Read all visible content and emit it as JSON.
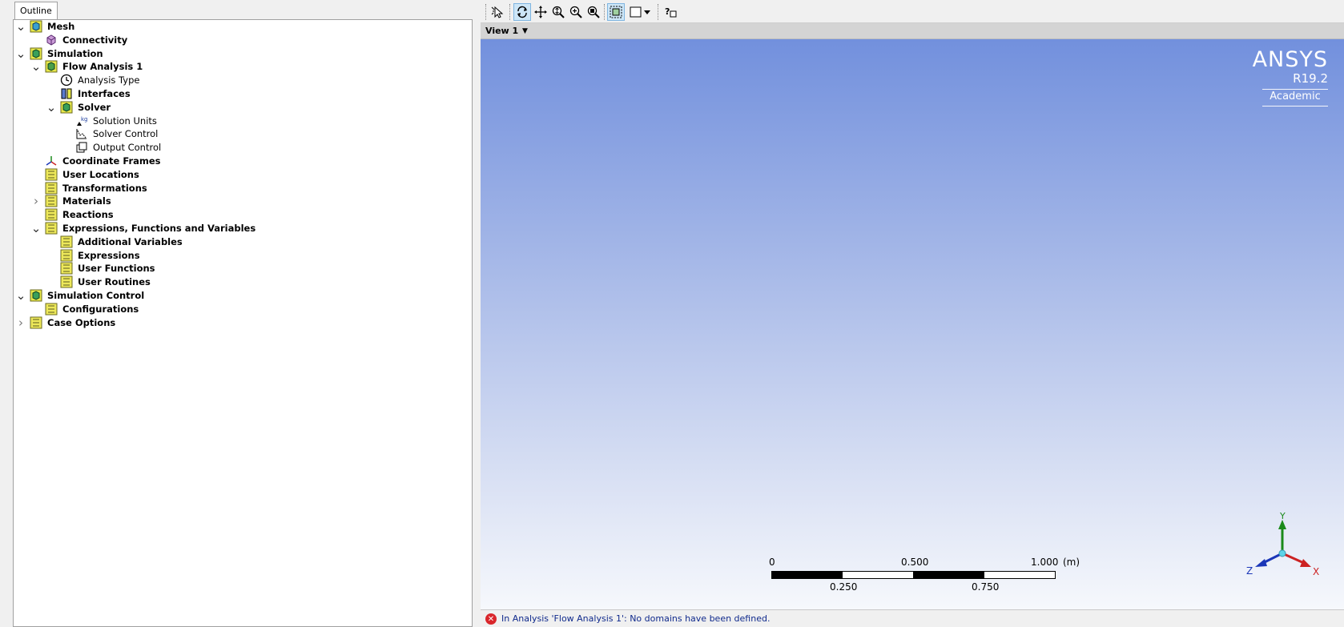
{
  "outline": {
    "tab_label": "Outline",
    "items": [
      {
        "label": "Mesh",
        "bold": true,
        "twisty": "expanded",
        "icon": "mesh-icon"
      },
      {
        "label": "Connectivity",
        "bold": true,
        "twisty": "none",
        "icon": "connectivity-icon"
      },
      {
        "label": "Simulation",
        "bold": true,
        "twisty": "expanded",
        "icon": "simulation-icon"
      },
      {
        "label": "Flow Analysis 1",
        "bold": true,
        "twisty": "expanded",
        "icon": "flow-analysis-icon"
      },
      {
        "label": "Analysis Type",
        "bold": false,
        "twisty": "none",
        "icon": "clock-icon"
      },
      {
        "label": "Interfaces",
        "bold": true,
        "twisty": "none",
        "icon": "interfaces-icon"
      },
      {
        "label": "Solver",
        "bold": true,
        "twisty": "expanded",
        "icon": "solver-icon"
      },
      {
        "label": "Solution Units",
        "bold": false,
        "twisty": "none",
        "icon": "solution-units-icon"
      },
      {
        "label": "Solver Control",
        "bold": false,
        "twisty": "none",
        "icon": "solver-control-icon"
      },
      {
        "label": "Output Control",
        "bold": false,
        "twisty": "none",
        "icon": "output-control-icon"
      },
      {
        "label": "Coordinate Frames",
        "bold": true,
        "twisty": "none",
        "icon": "coordinate-frames-icon"
      },
      {
        "label": "User Locations",
        "bold": true,
        "twisty": "none",
        "icon": "folder-icon"
      },
      {
        "label": "Transformations",
        "bold": true,
        "twisty": "none",
        "icon": "folder-icon"
      },
      {
        "label": "Materials",
        "bold": true,
        "twisty": "collapsed",
        "icon": "folder-icon"
      },
      {
        "label": "Reactions",
        "bold": true,
        "twisty": "none",
        "icon": "folder-icon"
      },
      {
        "label": "Expressions, Functions and Variables",
        "bold": true,
        "twisty": "expanded",
        "icon": "folder-icon"
      },
      {
        "label": "Additional Variables",
        "bold": true,
        "twisty": "none",
        "icon": "folder-icon"
      },
      {
        "label": "Expressions",
        "bold": true,
        "twisty": "none",
        "icon": "folder-icon"
      },
      {
        "label": "User Functions",
        "bold": true,
        "twisty": "none",
        "icon": "folder-icon"
      },
      {
        "label": "User Routines",
        "bold": true,
        "twisty": "none",
        "icon": "folder-icon"
      },
      {
        "label": "Simulation Control",
        "bold": true,
        "twisty": "expanded",
        "icon": "simulation-icon"
      },
      {
        "label": "Configurations",
        "bold": true,
        "twisty": "none",
        "icon": "folder-icon"
      },
      {
        "label": "Case Options",
        "bold": true,
        "twisty": "collapsed",
        "icon": "folder-icon"
      }
    ]
  },
  "toolbar": {
    "buttons": [
      "select-icon",
      "rotate-icon",
      "pan-icon",
      "zoom-icon",
      "zoom-box-icon",
      "zoom-fit-icon",
      "fit-view-icon",
      "display-mode-icon",
      "help-icon"
    ]
  },
  "view": {
    "label": "View 1"
  },
  "logo": {
    "brand": "ANSYS",
    "version": "R19.2",
    "edition": "Academic"
  },
  "scale_bar": {
    "top_labels": [
      "0",
      "0.500",
      "1.000"
    ],
    "bottom_labels": [
      "0.250",
      "0.750"
    ],
    "unit": "(m)"
  },
  "triad": {
    "x_label": "X",
    "y_label": "Y",
    "z_label": "Z"
  },
  "status": {
    "message": "In Analysis 'Flow Analysis 1': No domains have been defined."
  },
  "colors": {
    "viewport_top": "#7290dd",
    "viewport_bottom": "#f6f8fc",
    "error_red": "#d9262b",
    "status_text": "#102a8c"
  }
}
